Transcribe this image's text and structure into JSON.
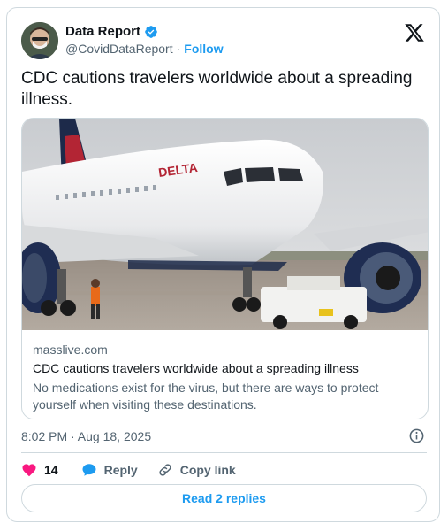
{
  "author": {
    "name": "Data Report",
    "handle": "@CovidDataReport",
    "separator": "·",
    "follow_label": "Follow"
  },
  "tweet": {
    "text": "CDC cautions travelers worldwide about a spreading illness."
  },
  "link_card": {
    "domain": "masslive.com",
    "title": "CDC cautions travelers worldwide about a spreading illness",
    "description": "No medications exist for the virus, but there are ways to protect yourself when visiting these destinations.",
    "image": "airliner-on-tarmac-photo"
  },
  "timestamp": "8:02 PM · Aug 18, 2025",
  "actions": {
    "like_count": "14",
    "reply_label": "Reply",
    "copy_label": "Copy link"
  },
  "read_replies_label": "Read 2 replies",
  "colors": {
    "accent": "#1d9bf0",
    "like": "#f91880",
    "text": "#0f1419",
    "muted": "#536471",
    "border": "#cfd9de"
  },
  "icons": [
    "verified-badge-icon",
    "x-logo-icon",
    "info-icon",
    "heart-icon",
    "reply-bubble-icon",
    "link-icon"
  ]
}
